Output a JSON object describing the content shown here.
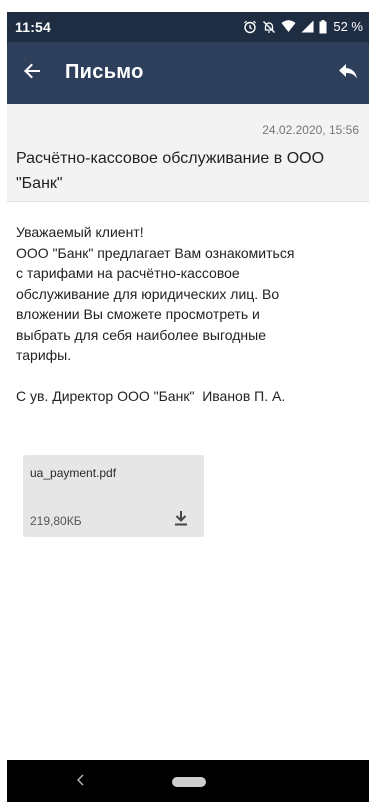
{
  "status_bar": {
    "time": "11:54",
    "battery": "52 %",
    "icons": [
      "alarm-icon",
      "dnd-off-icon",
      "wifi-icon",
      "signal-icon",
      "battery-icon"
    ]
  },
  "app_bar": {
    "title": "Письмо",
    "back_icon": "arrow-left-icon",
    "reply_icon": "reply-icon"
  },
  "letter": {
    "date": "24.02.2020, 15:56",
    "subject": "Расчётно-кассовое обслуживание в ООО \"Банк\"",
    "body": "Уважаемый клиент!\nООО \"Банк\" предлагает Вам ознакомиться\nс тарифами на расчётно-кассовое\nобслуживание для юридических лиц. Во\nвложении Вы сможете просмотреть и\nвыбрать для себя наиболее выгодные\nтарифы.",
    "signature": "С ув. Директор ООО \"Банк\"  Иванов П. А."
  },
  "attachment": {
    "file_name": "ua_payment.pdf",
    "file_size": "219,80КБ",
    "download_icon": "download-icon"
  },
  "colors": {
    "status_bar_bg": "#1f2d43",
    "app_bar_bg": "#2e3f5c",
    "header_bg": "#f3f3f3",
    "attachment_bg": "#e6e6e6"
  }
}
